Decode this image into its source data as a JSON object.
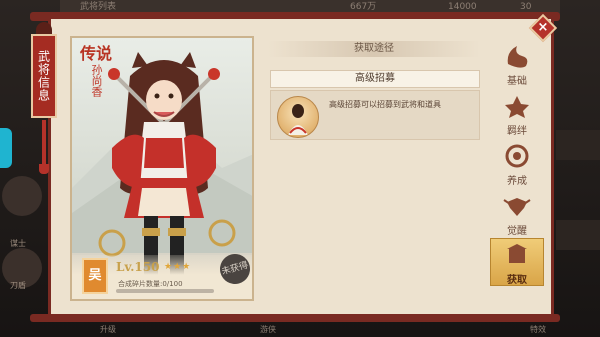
{
  "background": {
    "top_title": "武将列表",
    "top_values": [
      "667万",
      "14000",
      "30"
    ],
    "left_labels": [
      "谋士",
      "刀盾"
    ],
    "bottom_labels": [
      "升级",
      "游侠",
      "特效"
    ]
  },
  "title_banner": "武将信息",
  "close_label": "×",
  "hero": {
    "rarity": "传说",
    "name": "孙尚香",
    "faction": "吴",
    "level": "Lv.150",
    "stars": "★★★",
    "fragments": "合成碎片数量:0/100",
    "fragment_progress": 0,
    "stamp": "未获得"
  },
  "acquire": {
    "section_title": "获取途径",
    "sources": [
      {
        "name": "高级招募",
        "description": "高级招募可以招募到武将和道具"
      }
    ]
  },
  "tabs": [
    {
      "label": "基础",
      "icon": "base-icon",
      "active": false
    },
    {
      "label": "羁绊",
      "icon": "bond-icon",
      "active": false
    },
    {
      "label": "养成",
      "icon": "cultivate-icon",
      "active": false
    },
    {
      "label": "觉醒",
      "icon": "awaken-icon",
      "active": false
    },
    {
      "label": "获取",
      "icon": "acquire-icon",
      "active": true
    }
  ],
  "colors": {
    "frame": "#7a2a22",
    "panel": "#ede2cf",
    "accent": "#c0392b",
    "active_tab": "#e2b35c"
  }
}
